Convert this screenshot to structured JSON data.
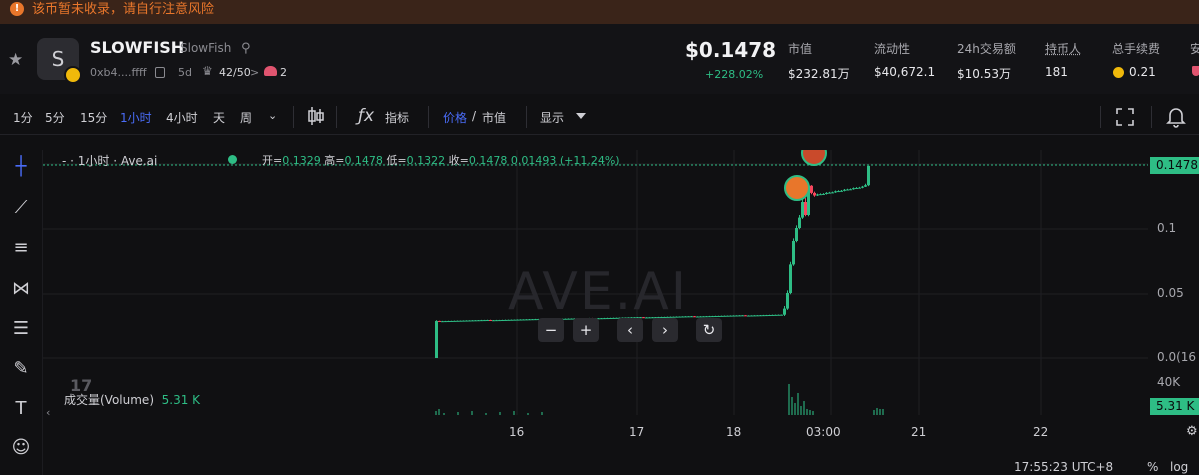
{
  "warning": {
    "text": "该币暂未收录，请自行注意风险"
  },
  "token": {
    "logo_letter": "S",
    "symbol": "SLOWFISH",
    "name": "SlowFish",
    "address": "0xb4....ffff",
    "age": "5d",
    "score": "42/50",
    "risk_count": "2"
  },
  "price": {
    "value": "$0.1478",
    "change": "+228.02%"
  },
  "stats": [
    {
      "label": "市值",
      "value": "$232.81万"
    },
    {
      "label": "流动性",
      "value": "$40,672.1"
    },
    {
      "label": "24h交易额",
      "value": "$10.53万"
    },
    {
      "label": "持币人",
      "value": "181"
    },
    {
      "label": "总手续费",
      "value": "0.21"
    },
    {
      "label": "安",
      "value": ""
    }
  ],
  "toolbar": {
    "timeframes": [
      "1分",
      "5分",
      "15分",
      "1小时",
      "4小时",
      "天",
      "周"
    ],
    "active_timeframe": "1小时",
    "indicator_label": "指标",
    "price_label": "价格",
    "slash": "/",
    "mcap_label": "市值",
    "display_label": "显示"
  },
  "legend": {
    "title": "1小时 · Ave.ai",
    "prefix": "-  · ",
    "open_label": "开=",
    "open": "0.1329",
    "high_label": "高=",
    "high": "0.1478",
    "low_label": "低=",
    "low": "0.1322",
    "close_label": "收=",
    "close": "0.1478",
    "change": "0.01493 (+11.24%)"
  },
  "price_axis": {
    "labels": [
      "0.1",
      "0.05",
      "0.0(16"
    ],
    "last_price": "0.1478"
  },
  "volume": {
    "label": "成交量(Volume)",
    "value": "5.31 K",
    "axis_top": "40K",
    "tag": "5.31 K"
  },
  "time_axis": {
    "labels": [
      "16",
      "17",
      "18",
      "03:00",
      "21",
      "22"
    ]
  },
  "watermark": "AVE.AI",
  "tv_logo": "17",
  "footer": {
    "clock": "17:55:23 UTC+8",
    "pct": "%",
    "log": "log"
  },
  "colors": {
    "up": "#2ebd85",
    "down": "#f6465d",
    "accent": "#4a6cf7",
    "warning": "#e8762b"
  },
  "chart_data": {
    "type": "candlestick",
    "interval": "1小时",
    "last": {
      "open": 0.1329,
      "high": 0.1478,
      "low": 0.1322,
      "close": 0.1478
    }
  }
}
